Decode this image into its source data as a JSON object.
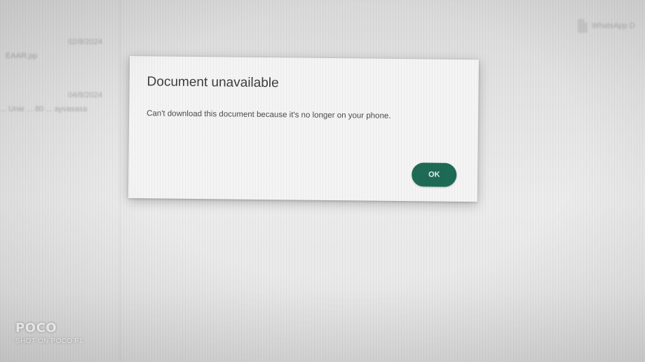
{
  "background": {
    "chat_list": [
      {
        "date": "02/8/2024",
        "name": "EAAR.pp"
      },
      {
        "date": "04/8/2024",
        "name": "... Unie ... 80 ... ayvasasa"
      }
    ],
    "file_chip": {
      "icon": "document-icon",
      "name": "WhatsApp D"
    }
  },
  "dialog": {
    "title": "Document unavailable",
    "message": "Can't download this document because it's no longer on your phone.",
    "ok_label": "OK",
    "accent_color": "#1e6b55"
  },
  "watermark": {
    "brand": "POCO",
    "subtitle": "SHOT ON POCO F1"
  }
}
